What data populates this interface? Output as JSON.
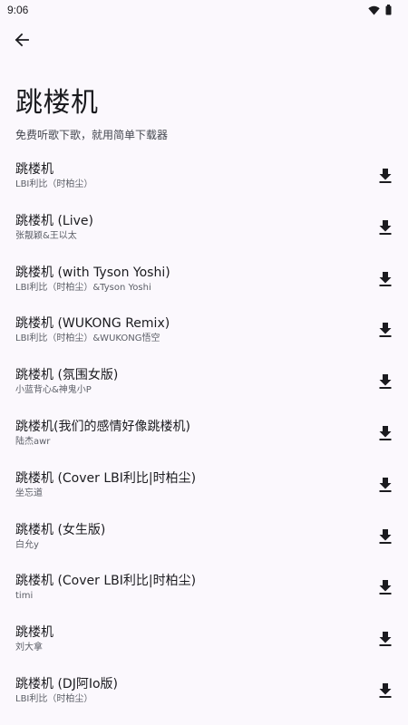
{
  "status": {
    "time": "9:06"
  },
  "header": {
    "title": "跳楼机",
    "subtitle": "免费听歌下歌，就用简单下载器"
  },
  "songs": [
    {
      "title": "跳楼机",
      "artist": "LBI利比（时柏尘）"
    },
    {
      "title": "跳楼机 (Live)",
      "artist": "张靓颖&王以太"
    },
    {
      "title": "跳楼机 (with Tyson Yoshi)",
      "artist": "LBI利比（时柏尘）&Tyson Yoshi"
    },
    {
      "title": "跳楼机 (WUKONG Remix)",
      "artist": "LBI利比（时柏尘）&WUKONG悟空"
    },
    {
      "title": "跳楼机 (氛围女版)",
      "artist": "小蓝背心&神鬼小P"
    },
    {
      "title": "跳楼机(我们的感情好像跳楼机)",
      "artist": "陆杰awr"
    },
    {
      "title": "跳楼机 (Cover LBI利比|时柏尘)",
      "artist": "坐忘道"
    },
    {
      "title": "跳楼机 (女生版)",
      "artist": "白允y"
    },
    {
      "title": "跳楼机 (Cover LBI利比|时柏尘)",
      "artist": "timi"
    },
    {
      "title": "跳楼机",
      "artist": "刘大拿"
    },
    {
      "title": "跳楼机 (DJ阿Io版)",
      "artist": "LBI利比（时柏尘）"
    }
  ],
  "icons": {
    "back": "arrow-back-icon",
    "download": "download-icon",
    "wifi": "wifi-icon",
    "battery": "battery-icon"
  }
}
